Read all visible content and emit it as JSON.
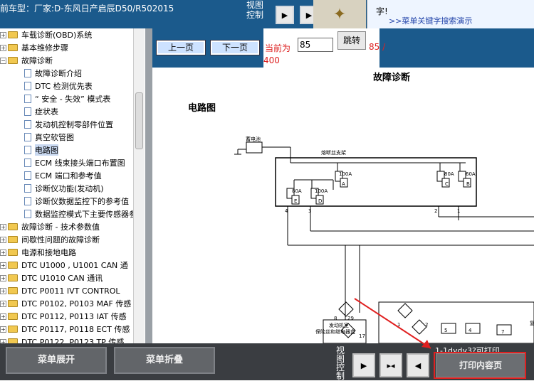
{
  "header": {
    "vehicle": "前车型：厂家:D-东风日产启辰D50/R502015",
    "view_control": "视图控制"
  },
  "help": {
    "line1": "字!",
    "line2": "",
    "link": ">>菜单关键字搜索演示"
  },
  "tree": {
    "items": [
      {
        "label": "车载诊断(OBD)系统",
        "type": "folder",
        "level": 0
      },
      {
        "label": "基本维修步骤",
        "type": "folder",
        "level": 0
      },
      {
        "label": "故障诊断",
        "type": "folder",
        "level": 0,
        "expanded": true
      },
      {
        "label": "故障诊断介绍",
        "type": "doc",
        "level": 1
      },
      {
        "label": "DTC 检测优先表",
        "type": "doc",
        "level": 1
      },
      {
        "label": "“ 安全 - 失效” 模式表",
        "type": "doc",
        "level": 1
      },
      {
        "label": "症状表",
        "type": "doc",
        "level": 1
      },
      {
        "label": "发动机控制零部件位置",
        "type": "doc",
        "level": 1
      },
      {
        "label": "真空软管图",
        "type": "doc",
        "level": 1
      },
      {
        "label": "电路图",
        "type": "doc",
        "level": 1,
        "selected": true
      },
      {
        "label": "ECM 线束接头端口布置图",
        "type": "doc",
        "level": 1
      },
      {
        "label": "ECM 端口和参考值",
        "type": "doc",
        "level": 1
      },
      {
        "label": "诊断仪功能(发动机)",
        "type": "doc",
        "level": 1
      },
      {
        "label": "诊断仪数据监控下的参考值",
        "type": "doc",
        "level": 1
      },
      {
        "label": "数据监控模式下主要传感器参",
        "type": "doc",
        "level": 1
      },
      {
        "label": "故障诊断 - 技术参数值",
        "type": "folder",
        "level": 0
      },
      {
        "label": "间歇性问题的故障诊断",
        "type": "folder",
        "level": 0
      },
      {
        "label": "电源和接地电路",
        "type": "folder",
        "level": 0
      },
      {
        "label": "DTC U1000 , U1001 CAN 通",
        "type": "folder",
        "level": 0
      },
      {
        "label": "DTC U1010 CAN 通讯",
        "type": "folder",
        "level": 0
      },
      {
        "label": "DTC P0011 IVT CONTROL",
        "type": "folder",
        "level": 0
      },
      {
        "label": "DTC P0102, P0103 MAF 传感",
        "type": "folder",
        "level": 0
      },
      {
        "label": "DTC P0112, P0113 IAT 传感",
        "type": "folder",
        "level": 0
      },
      {
        "label": "DTC P0117, P0118 ECT 传感",
        "type": "folder",
        "level": 0
      },
      {
        "label": "DTC P0122, P0123 TP 传感",
        "type": "folder",
        "level": 0
      }
    ]
  },
  "nav": {
    "prev": "上一页",
    "next": "下一页",
    "current_label": "当前为",
    "current_value": "85",
    "jump": "跳转",
    "page_count": "85 /",
    "page_total": "400"
  },
  "doc": {
    "title": "故障诊断",
    "section": "电路图",
    "battery": "蓄电池",
    "fusebox": "熔断丝支架",
    "f1": "100A",
    "f1p": "A",
    "f2": "80A",
    "f2p": "C",
    "f3": "60A",
    "f3p": "B",
    "f4": "80A",
    "f4p": "E",
    "f5": "100A",
    "f5p": "D",
    "pin4": "4",
    "pin3": "3",
    "pin2": "2",
    "pin1": "1",
    "relay1": "发动机室",
    "relay2": "保险丝和继电器盒",
    "n8": "8",
    "n29": "29",
    "n17": "17",
    "n1": "1",
    "n2": "2",
    "n5": "5",
    "n4": "4",
    "n7": "7",
    "nn": "复"
  },
  "bottom": {
    "expand": "菜单展开",
    "collapse": "菜单折叠",
    "view_control": "视图控制",
    "print_hint": "1-1dydy3?可打印",
    "print": "打印内容页"
  }
}
